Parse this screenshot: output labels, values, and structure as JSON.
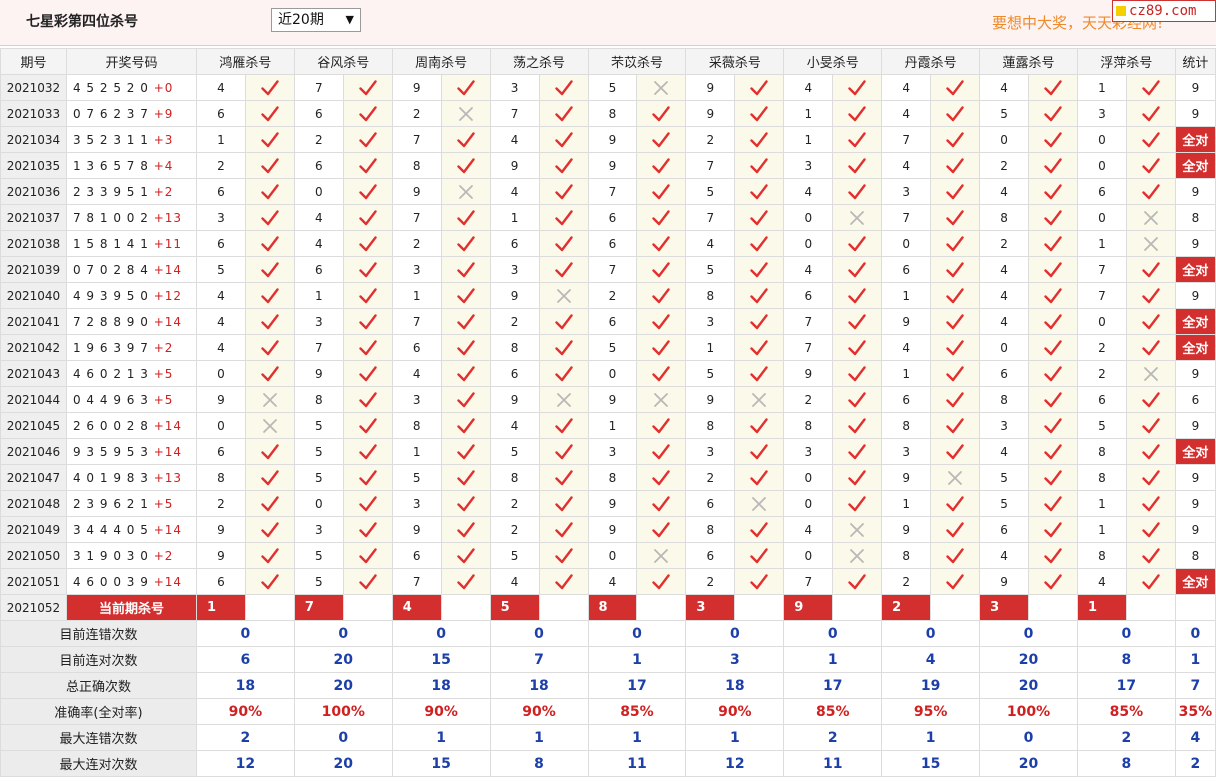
{
  "header": {
    "title": "七星彩第四位杀号",
    "period_select": "近20期",
    "slogan": "要想中大奖，天天彩经网!",
    "brand": "cz89.com"
  },
  "table": {
    "columns": {
      "period": "期号",
      "draw": "开奖号码",
      "experts": [
        "鸿雁杀号",
        "谷风杀号",
        "周南杀号",
        "荡之杀号",
        "芣苡杀号",
        "采薇杀号",
        "小旻杀号",
        "丹霞杀号",
        "蓮露杀号",
        "浮萍杀号"
      ],
      "stat": "统计"
    },
    "rows": [
      {
        "period": "2021032",
        "digits": "4 5 2 5 2 0",
        "sum": "+0",
        "kills": [
          "4",
          "7",
          "9",
          "3",
          "5",
          "9",
          "4",
          "4",
          "4",
          "1"
        ],
        "ok": [
          1,
          1,
          1,
          1,
          0,
          1,
          1,
          1,
          1,
          1
        ],
        "count": "9"
      },
      {
        "period": "2021033",
        "digits": "0 7 6 2 3 7",
        "sum": "+9",
        "kills": [
          "6",
          "6",
          "2",
          "7",
          "8",
          "9",
          "1",
          "4",
          "5",
          "3"
        ],
        "ok": [
          1,
          1,
          0,
          1,
          1,
          1,
          1,
          1,
          1,
          1
        ],
        "count": "9"
      },
      {
        "period": "2021034",
        "digits": "3 5 2 3 1 1",
        "sum": "+3",
        "kills": [
          "1",
          "2",
          "7",
          "4",
          "9",
          "2",
          "1",
          "7",
          "0",
          "0"
        ],
        "ok": [
          1,
          1,
          1,
          1,
          1,
          1,
          1,
          1,
          1,
          1
        ],
        "count": "全对"
      },
      {
        "period": "2021035",
        "digits": "1 3 6 5 7 8",
        "sum": "+4",
        "kills": [
          "2",
          "6",
          "8",
          "9",
          "9",
          "7",
          "3",
          "4",
          "2",
          "0"
        ],
        "ok": [
          1,
          1,
          1,
          1,
          1,
          1,
          1,
          1,
          1,
          1
        ],
        "count": "全对"
      },
      {
        "period": "2021036",
        "digits": "2 3 3 9 5 1",
        "sum": "+2",
        "kills": [
          "6",
          "0",
          "9",
          "4",
          "7",
          "5",
          "4",
          "3",
          "4",
          "6"
        ],
        "ok": [
          1,
          1,
          0,
          1,
          1,
          1,
          1,
          1,
          1,
          1
        ],
        "count": "9"
      },
      {
        "period": "2021037",
        "digits": "7 8 1 0 0 2",
        "sum": "+13",
        "kills": [
          "3",
          "4",
          "7",
          "1",
          "6",
          "7",
          "0",
          "7",
          "8",
          "0"
        ],
        "ok": [
          1,
          1,
          1,
          1,
          1,
          1,
          0,
          1,
          1,
          0
        ],
        "count": "8"
      },
      {
        "period": "2021038",
        "digits": "1 5 8 1 4 1",
        "sum": "+11",
        "kills": [
          "6",
          "4",
          "2",
          "6",
          "6",
          "4",
          "0",
          "0",
          "2",
          "1"
        ],
        "ok": [
          1,
          1,
          1,
          1,
          1,
          1,
          1,
          1,
          1,
          0
        ],
        "count": "9"
      },
      {
        "period": "2021039",
        "digits": "0 7 0 2 8 4",
        "sum": "+14",
        "kills": [
          "5",
          "6",
          "3",
          "3",
          "7",
          "5",
          "4",
          "6",
          "4",
          "7"
        ],
        "ok": [
          1,
          1,
          1,
          1,
          1,
          1,
          1,
          1,
          1,
          1
        ],
        "count": "全对"
      },
      {
        "period": "2021040",
        "digits": "4 9 3 9 5 0",
        "sum": "+12",
        "kills": [
          "4",
          "1",
          "1",
          "9",
          "2",
          "8",
          "6",
          "1",
          "4",
          "7"
        ],
        "ok": [
          1,
          1,
          1,
          0,
          1,
          1,
          1,
          1,
          1,
          1
        ],
        "count": "9"
      },
      {
        "period": "2021041",
        "digits": "7 2 8 8 9 0",
        "sum": "+14",
        "kills": [
          "4",
          "3",
          "7",
          "2",
          "6",
          "3",
          "7",
          "9",
          "4",
          "0"
        ],
        "ok": [
          1,
          1,
          1,
          1,
          1,
          1,
          1,
          1,
          1,
          1
        ],
        "count": "全对"
      },
      {
        "period": "2021042",
        "digits": "1 9 6 3 9 7",
        "sum": "+2",
        "kills": [
          "4",
          "7",
          "6",
          "8",
          "5",
          "1",
          "7",
          "4",
          "0",
          "2"
        ],
        "ok": [
          1,
          1,
          1,
          1,
          1,
          1,
          1,
          1,
          1,
          1
        ],
        "count": "全对"
      },
      {
        "period": "2021043",
        "digits": "4 6 0 2 1 3",
        "sum": "+5",
        "kills": [
          "0",
          "9",
          "4",
          "6",
          "0",
          "5",
          "9",
          "1",
          "6",
          "2"
        ],
        "ok": [
          1,
          1,
          1,
          1,
          1,
          1,
          1,
          1,
          1,
          0
        ],
        "count": "9"
      },
      {
        "period": "2021044",
        "digits": "0 4 4 9 6 3",
        "sum": "+5",
        "kills": [
          "9",
          "8",
          "3",
          "9",
          "9",
          "9",
          "2",
          "6",
          "8",
          "6"
        ],
        "ok": [
          0,
          1,
          1,
          0,
          0,
          0,
          1,
          1,
          1,
          1
        ],
        "count": "6"
      },
      {
        "period": "2021045",
        "digits": "2 6 0 0 2 8",
        "sum": "+14",
        "kills": [
          "0",
          "5",
          "8",
          "4",
          "1",
          "8",
          "8",
          "8",
          "3",
          "5"
        ],
        "ok": [
          0,
          1,
          1,
          1,
          1,
          1,
          1,
          1,
          1,
          1
        ],
        "count": "9"
      },
      {
        "period": "2021046",
        "digits": "9 3 5 9 5 3",
        "sum": "+14",
        "kills": [
          "6",
          "5",
          "1",
          "5",
          "3",
          "3",
          "3",
          "3",
          "4",
          "8"
        ],
        "ok": [
          1,
          1,
          1,
          1,
          1,
          1,
          1,
          1,
          1,
          1
        ],
        "count": "全对"
      },
      {
        "period": "2021047",
        "digits": "4 0 1 9 8 3",
        "sum": "+13",
        "kills": [
          "8",
          "5",
          "5",
          "8",
          "8",
          "2",
          "0",
          "9",
          "5",
          "8"
        ],
        "ok": [
          1,
          1,
          1,
          1,
          1,
          1,
          1,
          0,
          1,
          1
        ],
        "count": "9"
      },
      {
        "period": "2021048",
        "digits": "2 3 9 6 2 1",
        "sum": "+5",
        "kills": [
          "2",
          "0",
          "3",
          "2",
          "9",
          "6",
          "0",
          "1",
          "5",
          "1"
        ],
        "ok": [
          1,
          1,
          1,
          1,
          1,
          0,
          1,
          1,
          1,
          1
        ],
        "count": "9"
      },
      {
        "period": "2021049",
        "digits": "3 4 4 4 0 5",
        "sum": "+14",
        "kills": [
          "9",
          "3",
          "9",
          "2",
          "9",
          "8",
          "4",
          "9",
          "6",
          "1"
        ],
        "ok": [
          1,
          1,
          1,
          1,
          1,
          1,
          0,
          1,
          1,
          1
        ],
        "count": "9"
      },
      {
        "period": "2021050",
        "digits": "3 1 9 0 3 0",
        "sum": "+2",
        "kills": [
          "9",
          "5",
          "6",
          "5",
          "0",
          "6",
          "0",
          "8",
          "4",
          "8"
        ],
        "ok": [
          1,
          1,
          1,
          1,
          0,
          1,
          0,
          1,
          1,
          1
        ],
        "count": "8"
      },
      {
        "period": "2021051",
        "digits": "4 6 0 0 3 9",
        "sum": "+14",
        "kills": [
          "6",
          "5",
          "7",
          "4",
          "4",
          "2",
          "7",
          "2",
          "9",
          "4"
        ],
        "ok": [
          1,
          1,
          1,
          1,
          1,
          1,
          1,
          1,
          1,
          1
        ],
        "count": "全对"
      }
    ],
    "current": {
      "period": "2021052",
      "label": "当前期杀号",
      "kills": [
        "1",
        "7",
        "4",
        "5",
        "8",
        "3",
        "9",
        "2",
        "3",
        "1"
      ]
    },
    "stats": [
      {
        "label": "目前连错次数",
        "values": [
          "0",
          "0",
          "0",
          "0",
          "0",
          "0",
          "0",
          "0",
          "0",
          "0",
          "0"
        ],
        "red": false
      },
      {
        "label": "目前连对次数",
        "values": [
          "6",
          "20",
          "15",
          "7",
          "1",
          "3",
          "1",
          "4",
          "20",
          "8",
          "1"
        ],
        "red": false
      },
      {
        "label": "总正确次数",
        "values": [
          "18",
          "20",
          "18",
          "18",
          "17",
          "18",
          "17",
          "19",
          "20",
          "17",
          "7"
        ],
        "red": false
      },
      {
        "label": "准确率(全对率)",
        "values": [
          "90%",
          "100%",
          "90%",
          "90%",
          "85%",
          "90%",
          "85%",
          "95%",
          "100%",
          "85%",
          "35%"
        ],
        "red": true
      },
      {
        "label": "最大连错次数",
        "values": [
          "2",
          "0",
          "1",
          "1",
          "1",
          "1",
          "2",
          "1",
          "0",
          "2",
          "4"
        ],
        "red": false
      },
      {
        "label": "最大连对次数",
        "values": [
          "12",
          "20",
          "15",
          "8",
          "11",
          "12",
          "11",
          "15",
          "20",
          "8",
          "2"
        ],
        "red": false
      }
    ]
  },
  "colors": {
    "check": "#e03030",
    "cross": "#b8b8b8",
    "accent_red": "#d32f2f",
    "stat_blue": "#1d3fa8",
    "slogan_orange": "#ef8a2a"
  },
  "icons": {
    "ok": "check-icon",
    "fail": "cross-icon"
  }
}
